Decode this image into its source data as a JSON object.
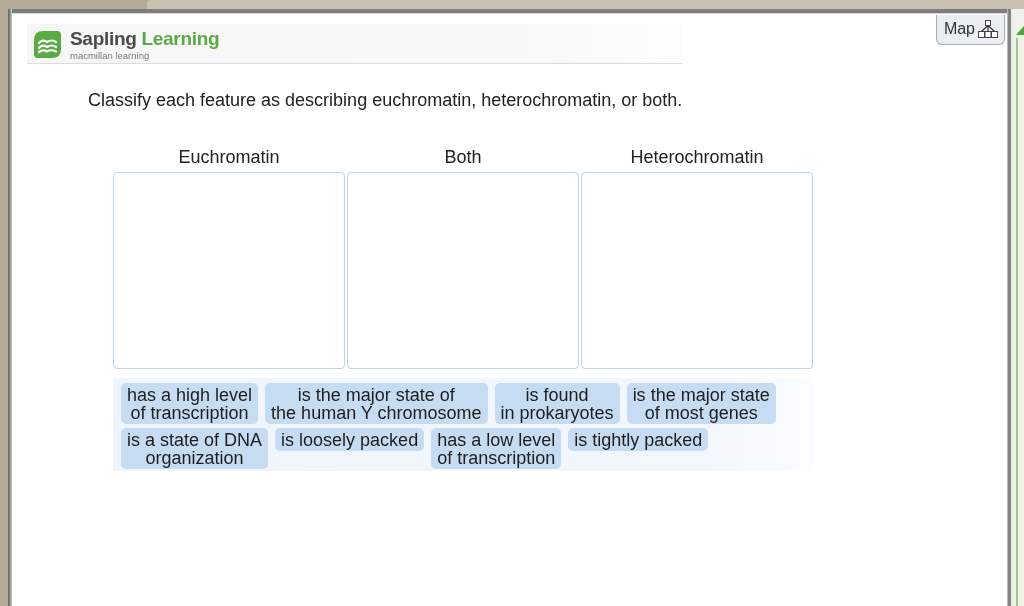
{
  "header": {
    "brand_words": [
      "Sapling",
      "Learning"
    ],
    "tagline": "macmillan learning"
  },
  "map_button": {
    "label": "Map"
  },
  "question": "Classify each feature as describing euchromatin, heterochromatin, or both.",
  "categories": [
    {
      "heading": "Euchromatin"
    },
    {
      "heading": "Both"
    },
    {
      "heading": "Heterochromatin"
    }
  ],
  "answer_tiles": [
    {
      "lines": [
        "has a high level",
        "of transcription"
      ]
    },
    {
      "lines": [
        "is the major state of",
        "the human Y chromosome"
      ]
    },
    {
      "lines": [
        "is found",
        "in prokaryotes"
      ]
    },
    {
      "lines": [
        "is the major state",
        "of most genes"
      ]
    },
    {
      "lines": [
        "is a state of DNA",
        "organization"
      ]
    },
    {
      "lines": [
        "is loosely packed"
      ]
    },
    {
      "lines": [
        "has a low level",
        "of transcription"
      ]
    },
    {
      "lines": [
        "is tightly packed"
      ]
    }
  ]
}
